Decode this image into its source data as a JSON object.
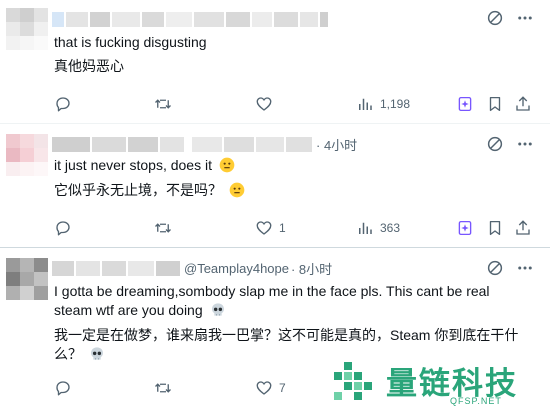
{
  "posts": [
    {
      "handle": "",
      "time": "",
      "text_en": "that is fucking disgusting",
      "text_zh": "真他妈恶心",
      "replies": "",
      "retweets": "",
      "likes": "",
      "views": "1,198"
    },
    {
      "handle": "",
      "time": "· 4小时",
      "text_en": "it just never stops, does it",
      "text_zh": "它似乎永无止境，不是吗？",
      "replies": "",
      "retweets": "",
      "likes": "1",
      "views": "363"
    },
    {
      "handle": "@Teamplay4hope",
      "time": "· 8小时",
      "text_en_1": "I gotta be dreaming,sombody slap me in the face pls. This cant be real",
      "text_en_2": "steam wtf are you doing",
      "text_zh_1": "我一定是在做梦，谁来扇我一巴掌？这不可能是真的，Steam 你到底在干什",
      "text_zh_2": "么？",
      "replies": "",
      "retweets": "",
      "likes": "7",
      "views": ""
    }
  ],
  "icons": {
    "reply": "reply-icon",
    "retweet": "retweet-icon",
    "like": "heart-icon",
    "views": "analytics-icon",
    "grok": "grok-icon",
    "bookmark": "bookmark-icon",
    "share": "share-icon",
    "more": "more-icon",
    "mute": "slash-circle-icon"
  },
  "watermark": {
    "title": "量链科技",
    "url": "QFSP.NET"
  },
  "colors": {
    "text": "#0f1419",
    "secondary": "#536471",
    "grok_accent": "#7856ff",
    "watermark": "#2aa57a"
  }
}
